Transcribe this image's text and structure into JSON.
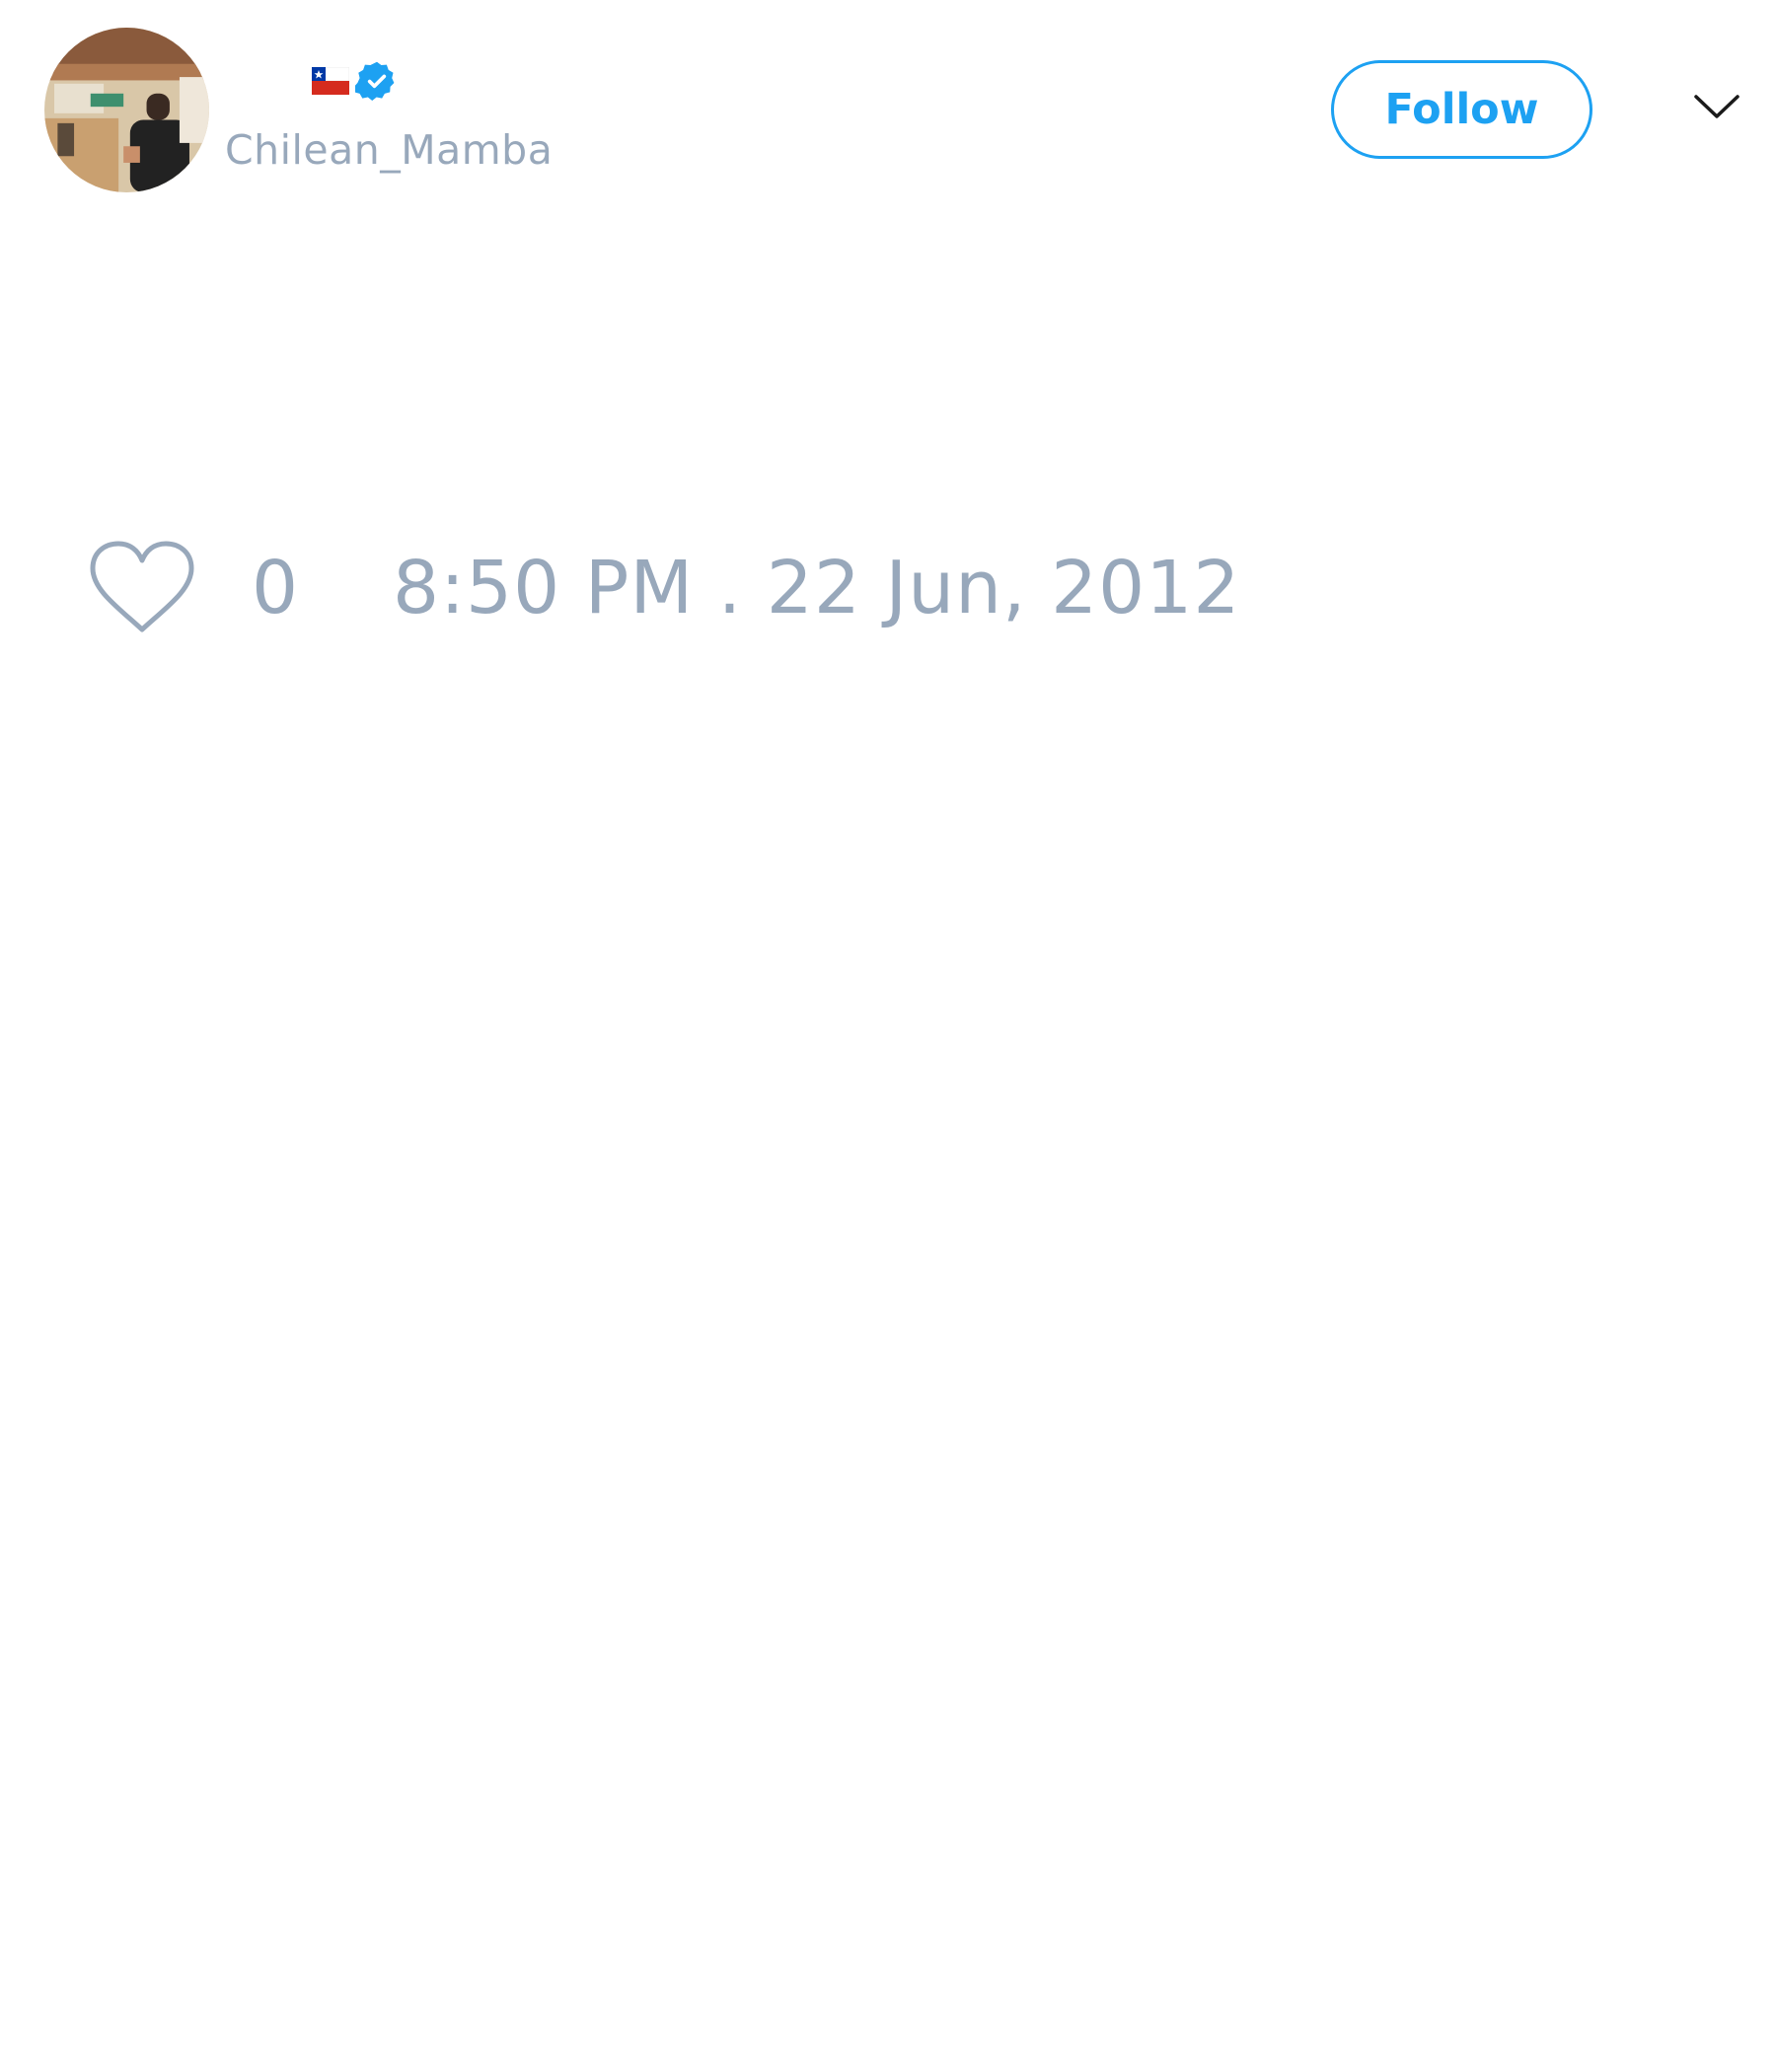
{
  "tweet": {
    "author": {
      "flag": "chile-flag-icon",
      "verified": true,
      "handle": "Chilean_Mamba"
    },
    "follow_label": "Follow",
    "like_count": "0",
    "timestamp": "8:50 PM . 22 Jun, 2012"
  },
  "colors": {
    "accent": "#1da1f2",
    "muted_text": "#98a8bb"
  }
}
